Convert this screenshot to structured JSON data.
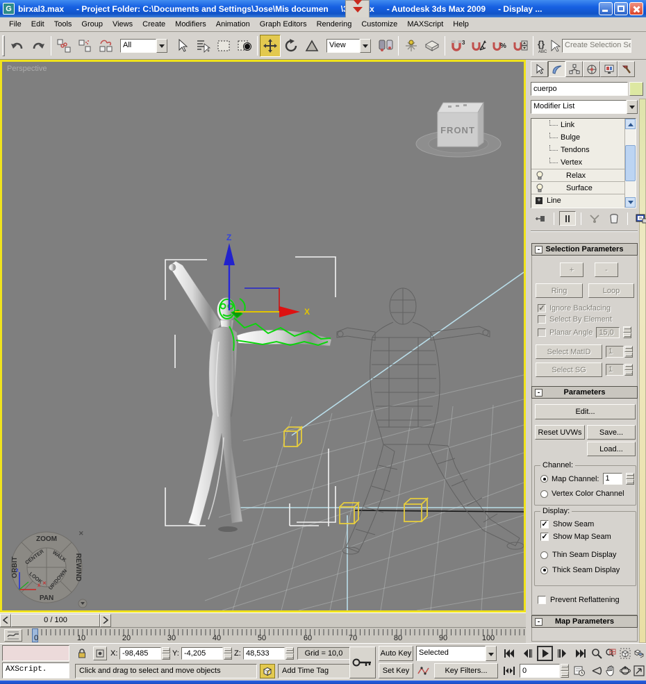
{
  "title_bar": {
    "app_icon_letter": "G",
    "segments": [
      "birxal3.max",
      "- Project Folder: C:\\Documents and Settings\\Jose\\Mis documen",
      "\\3dsmax",
      "- Autodesk 3ds Max  2009",
      "- Display ..."
    ]
  },
  "menu_bar": {
    "items": [
      "File",
      "Edit",
      "Tools",
      "Group",
      "Views",
      "Create",
      "Modifiers",
      "Animation",
      "Graph Editors",
      "Rendering",
      "Customize",
      "MAXScript",
      "Help"
    ]
  },
  "toolbar": {
    "filter_value": "All",
    "coord_value": "View",
    "selection_set_value": "Create Selection Set",
    "snap_count": "3",
    "percent": "%",
    "braces": "{}",
    "abc": "ABC"
  },
  "viewport": {
    "label": "Perspective",
    "viewcube_face": "FRONT",
    "gizmo": {
      "x_label": "X",
      "z_label": "Z"
    },
    "steering_wheel": {
      "zoom": "ZOOM",
      "rewind": "REWIND",
      "pan": "PAN",
      "orbit": "ORBIT",
      "center": "CENTER",
      "walk": "WALK",
      "look": "LOOK",
      "updown": "UP/DOWN",
      "close_x": "✕",
      "look_marker": "✕"
    }
  },
  "command_panel": {
    "object_name": "cuerpo",
    "modifier_list_label": "Modifier List",
    "stack": [
      {
        "label": "Link"
      },
      {
        "label": "Bulge"
      },
      {
        "label": "Tendons"
      },
      {
        "label": "Vertex"
      },
      {
        "label": "Relax"
      },
      {
        "label": "Surface"
      },
      {
        "label": "Line"
      }
    ],
    "plus_sign": "+",
    "selection_parameters": {
      "title": "Selection Parameters",
      "plus_label": "+",
      "minus_label": "-",
      "ring_label": "Ring",
      "loop_label": "Loop",
      "ignore_backfacing": "Ignore Backfacing",
      "select_by_element": "Select By Element",
      "planar_angle": "Planar Angle",
      "planar_angle_value": "15,0",
      "select_matid_label": "Select MatID",
      "matid_value": "1",
      "select_sg_label": "Select SG",
      "sg_value": "1"
    },
    "parameters": {
      "title": "Parameters",
      "edit_label": "Edit...",
      "reset_label": "Reset UVWs",
      "save_label": "Save...",
      "load_label": "Load...",
      "channel_title": "Channel:",
      "map_channel_label": "Map Channel:",
      "map_channel_value": "1",
      "vertex_color_label": "Vertex Color Channel",
      "display_title": "Display:",
      "show_seam": "Show Seam",
      "show_map_seam": "Show Map Seam",
      "thin_seam": "Thin Seam Display",
      "thick_seam": "Thick Seam Display",
      "prevent_reflattening": "Prevent Reflattening"
    },
    "map_parameters_title": "Map Parameters"
  },
  "time_slider": {
    "value": "0 / 100"
  },
  "track_bar": {
    "ticks": [
      "0",
      "10",
      "20",
      "30",
      "40",
      "50",
      "60",
      "70",
      "80",
      "90",
      "100"
    ]
  },
  "status_bar": {
    "listener_value": "AXScript.",
    "x_label": "X:",
    "x_value": "-98,485",
    "y_label": "Y:",
    "y_value": "-4,205",
    "z_label": "Z:",
    "z_value": "48,533",
    "grid_value": "Grid = 10,0",
    "prompt": "Click and drag to select and move objects",
    "add_time_tag": "Add Time Tag",
    "auto_key": "Auto Key",
    "set_key": "Set Key",
    "key_mode_value": "Selected",
    "key_filters": "Key Filters...",
    "frame_value": "0"
  }
}
